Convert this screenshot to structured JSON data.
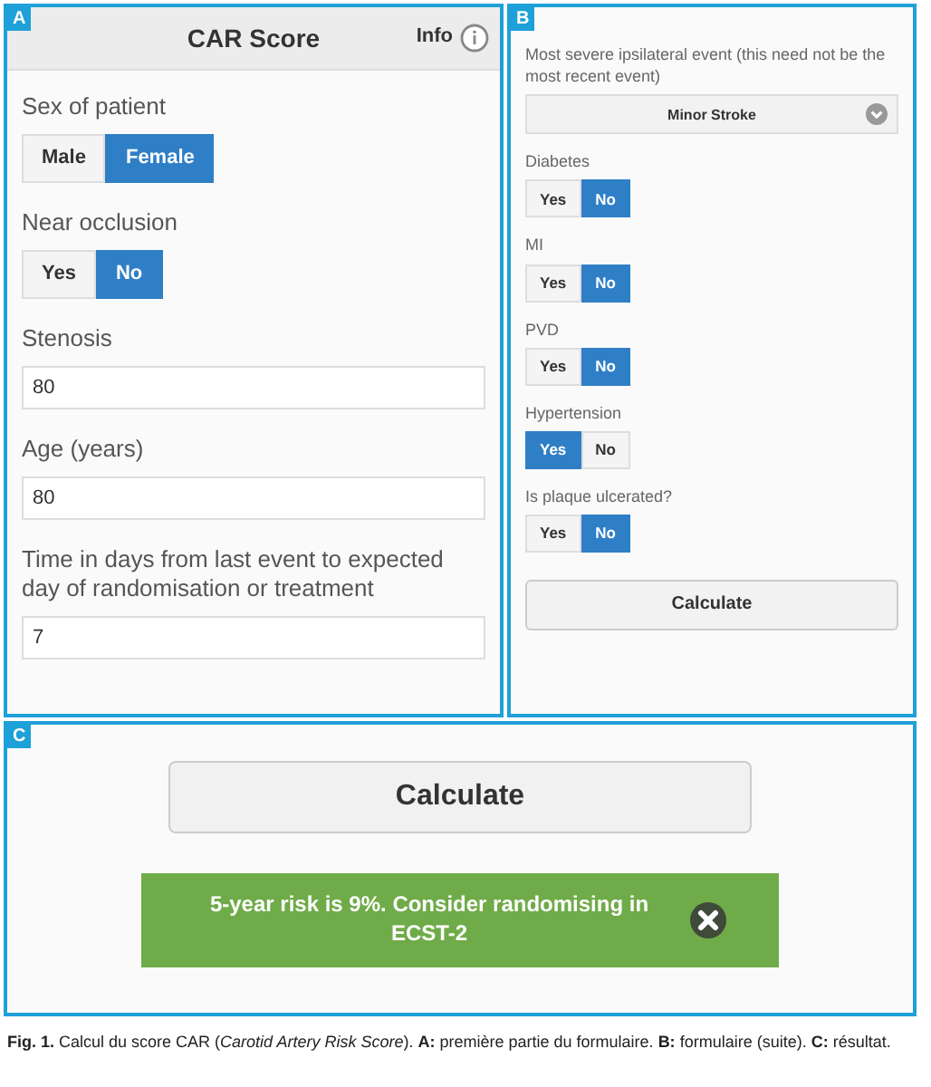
{
  "panel_a": {
    "label": "A",
    "title": "CAR Score",
    "info": "Info",
    "fields": [
      {
        "kind": "toggle",
        "label": "Sex of patient",
        "options": [
          {
            "label": "Male",
            "selected": false
          },
          {
            "label": "Female",
            "selected": true
          }
        ]
      },
      {
        "kind": "toggle",
        "label": "Near occlusion",
        "options": [
          {
            "label": "Yes",
            "selected": false
          },
          {
            "label": "No",
            "selected": true
          }
        ]
      },
      {
        "kind": "input",
        "label": "Stenosis",
        "value": "80"
      },
      {
        "kind": "input",
        "label": "Age (years)",
        "value": "80"
      },
      {
        "kind": "input",
        "label": "Time in days from last event to expected day of randomisation or treatment",
        "value": "7"
      }
    ]
  },
  "panel_b": {
    "label": "B",
    "fields": [
      {
        "kind": "select",
        "label": "Most severe ipsilateral event (this need not be the most recent event)",
        "value": "Minor Stroke"
      },
      {
        "kind": "toggle",
        "label": "Diabetes",
        "options": [
          {
            "label": "Yes",
            "selected": false
          },
          {
            "label": "No",
            "selected": true
          }
        ]
      },
      {
        "kind": "toggle",
        "label": "MI",
        "options": [
          {
            "label": "Yes",
            "selected": false
          },
          {
            "label": "No",
            "selected": true
          }
        ]
      },
      {
        "kind": "toggle",
        "label": "PVD",
        "options": [
          {
            "label": "Yes",
            "selected": false
          },
          {
            "label": "No",
            "selected": true
          }
        ]
      },
      {
        "kind": "toggle",
        "label": "Hypertension",
        "options": [
          {
            "label": "Yes",
            "selected": true
          },
          {
            "label": "No",
            "selected": false
          }
        ]
      },
      {
        "kind": "toggle",
        "label": "Is plaque ulcerated?",
        "options": [
          {
            "label": "Yes",
            "selected": false
          },
          {
            "label": "No",
            "selected": true
          }
        ]
      }
    ],
    "button": "Calculate"
  },
  "panel_c": {
    "label": "C",
    "button": "Calculate",
    "alert": "5-year risk is 9%. Consider randomising in ECST-2"
  },
  "caption": "**Fig. 1.** Calcul du score CAR (*Carotid Artery Risk Score*). **A:** première partie du formulaire. **B:** formulaire (suite). **C:** résultat."
}
